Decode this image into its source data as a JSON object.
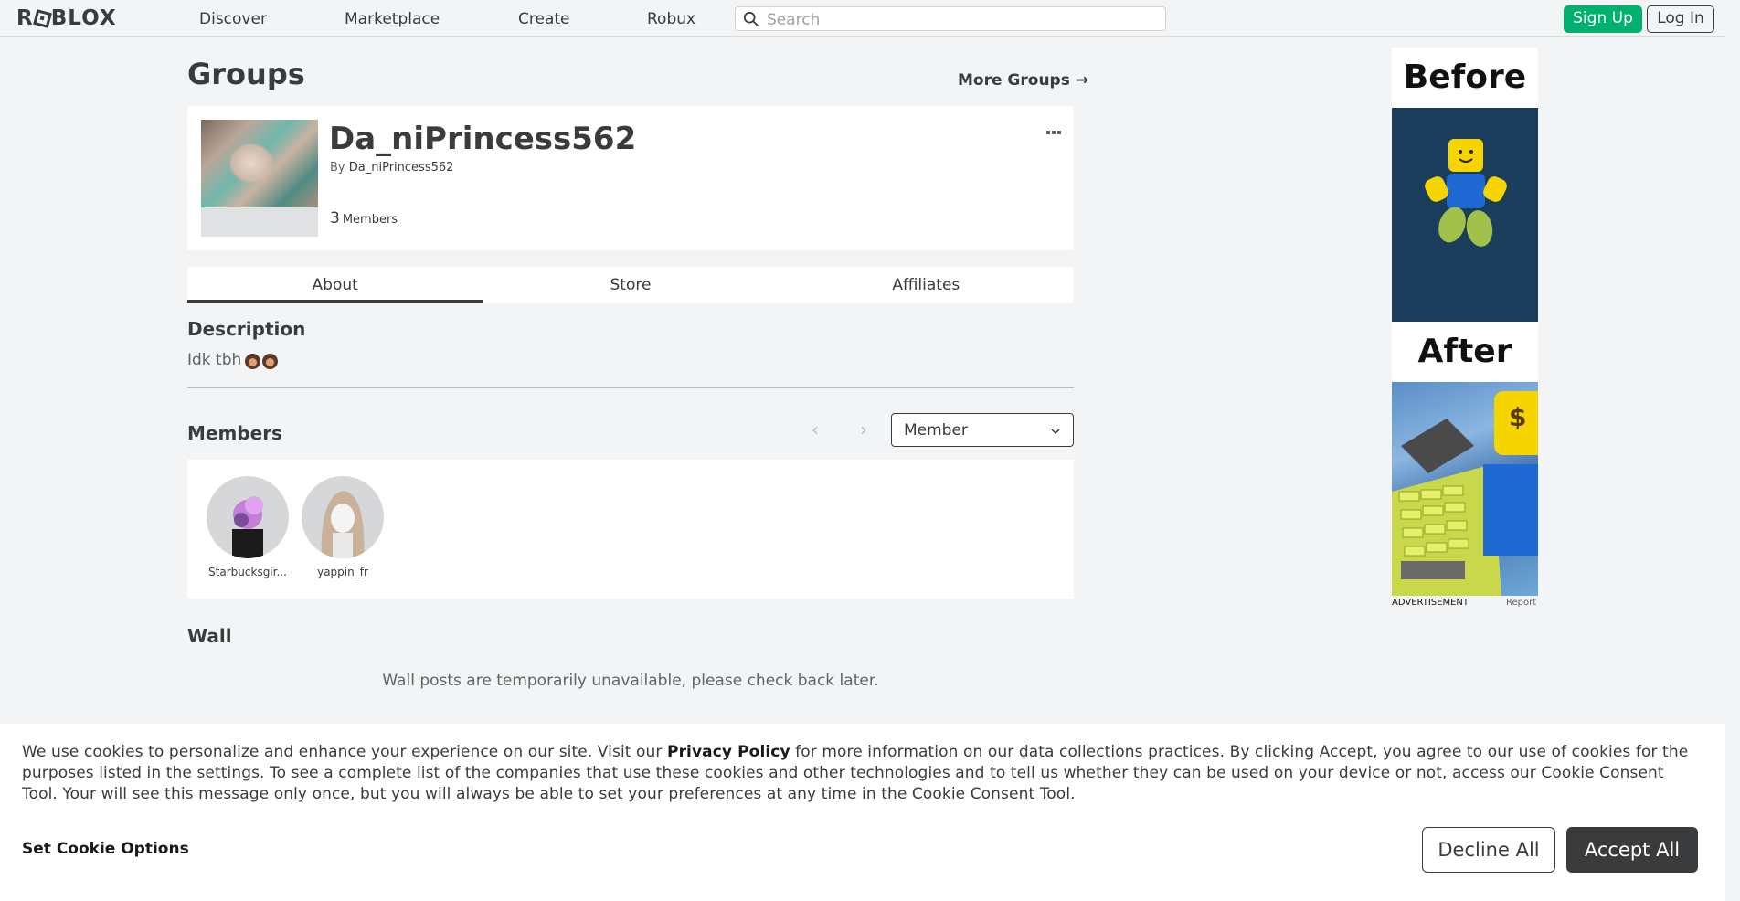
{
  "header": {
    "logo_text": "ROBLOX",
    "nav": [
      "Discover",
      "Marketplace",
      "Create",
      "Robux"
    ],
    "search_placeholder": "Search",
    "signup_label": "Sign Up",
    "login_label": "Log In"
  },
  "page": {
    "title": "Groups",
    "more_groups": "More Groups →"
  },
  "group": {
    "name": "Da_niPrincess562",
    "by_label": "By",
    "owner": "Da_niPrincess562",
    "member_count": "3",
    "members_label": "Members"
  },
  "tabs": [
    "About",
    "Store",
    "Affiliates"
  ],
  "about": {
    "description_title": "Description",
    "description_text": "Idk tbh"
  },
  "members_section": {
    "title": "Members",
    "role_selected": "Member",
    "members": [
      {
        "name": "Starbucksgir..."
      },
      {
        "name": "yappin_fr"
      }
    ]
  },
  "wall": {
    "title": "Wall",
    "message": "Wall posts are temporarily unavailable, please check back later."
  },
  "ad": {
    "before": "Before",
    "after": "After",
    "label": "ADVERTISEMENT",
    "report": "Report"
  },
  "cookie": {
    "text_before": "We use cookies to personalize and enhance your experience on our site. Visit our ",
    "policy_link": "Privacy Policy",
    "text_after": " for more information on our data collections practices. By clicking Accept, you agree to our use of cookies for the purposes listed in the settings. To see a complete list of the companies that use these cookies and other technologies and to tell us whether they can be used on your device or not, access our Cookie Consent Tool. Your will see this message only once, but you will always be able to set your preferences at any time in the Cookie Consent Tool.",
    "options_label": "Set Cookie Options",
    "decline_label": "Decline All",
    "accept_label": "Accept All"
  },
  "colors": {
    "accent_green": "#00b06f",
    "text_dark": "#393b3d",
    "page_bg": "#f2f4f5"
  },
  "icons": [
    "search-icon",
    "arrow-right-icon",
    "more-options-icon",
    "chevron-left-icon",
    "chevron-right-icon",
    "chevron-down-icon"
  ]
}
